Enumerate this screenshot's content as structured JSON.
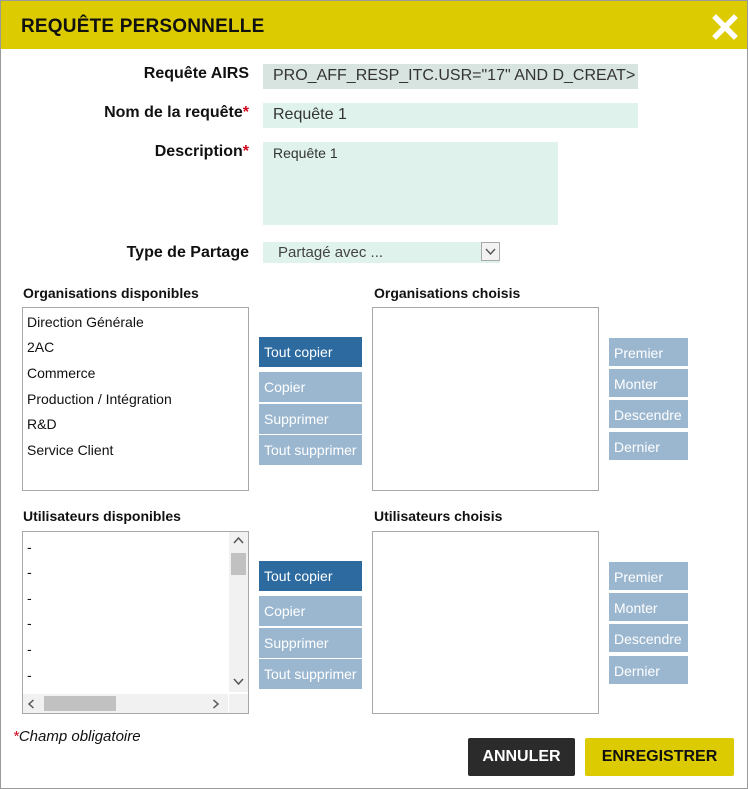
{
  "header": {
    "title": "REQUÊTE PERSONNELLE",
    "close_icon": "close-icon"
  },
  "form": {
    "requete_airs": {
      "label": "Requête AIRS",
      "value": "PRO_AFF_RESP_ITC.USR=\"17\" AND D_CREAT>"
    },
    "nom": {
      "label": "Nom de la requête",
      "required_mark": "*",
      "value": "Requête 1"
    },
    "description": {
      "label": "Description",
      "required_mark": "*",
      "value": "Requête 1"
    },
    "type_partage": {
      "label": "Type de Partage",
      "selected": "Partagé avec ..."
    }
  },
  "organisations": {
    "available_title": "Organisations disponibles",
    "chosen_title": "Organisations choisis",
    "available": [
      "Direction Générale",
      "2AC",
      "Commerce",
      "Production / Intégration",
      "R&D",
      "Service Client"
    ]
  },
  "utilisateurs": {
    "available_title": "Utilisateurs disponibles",
    "chosen_title": "Utilisateurs choisis",
    "available": [
      "-",
      "-",
      "-",
      "-",
      "-",
      "-"
    ]
  },
  "transfer_buttons": {
    "copy_all": "Tout copier",
    "copy": "Copier",
    "remove": "Supprimer",
    "remove_all": "Tout supprimer"
  },
  "order_buttons": {
    "first": "Premier",
    "up": "Monter",
    "down": "Descendre",
    "last": "Dernier"
  },
  "footer": {
    "required_mark": "*",
    "required_note": "Champ obligatoire",
    "cancel": "ANNULER",
    "save": "ENREGISTRER"
  },
  "colors": {
    "header": "#dccb00",
    "primary_button": "#2c6aa0",
    "disabled_button": "#9bb7d0",
    "field_bg": "#dff3ec",
    "cancel_bg": "#2b2b2b",
    "save_bg": "#dccb00"
  }
}
